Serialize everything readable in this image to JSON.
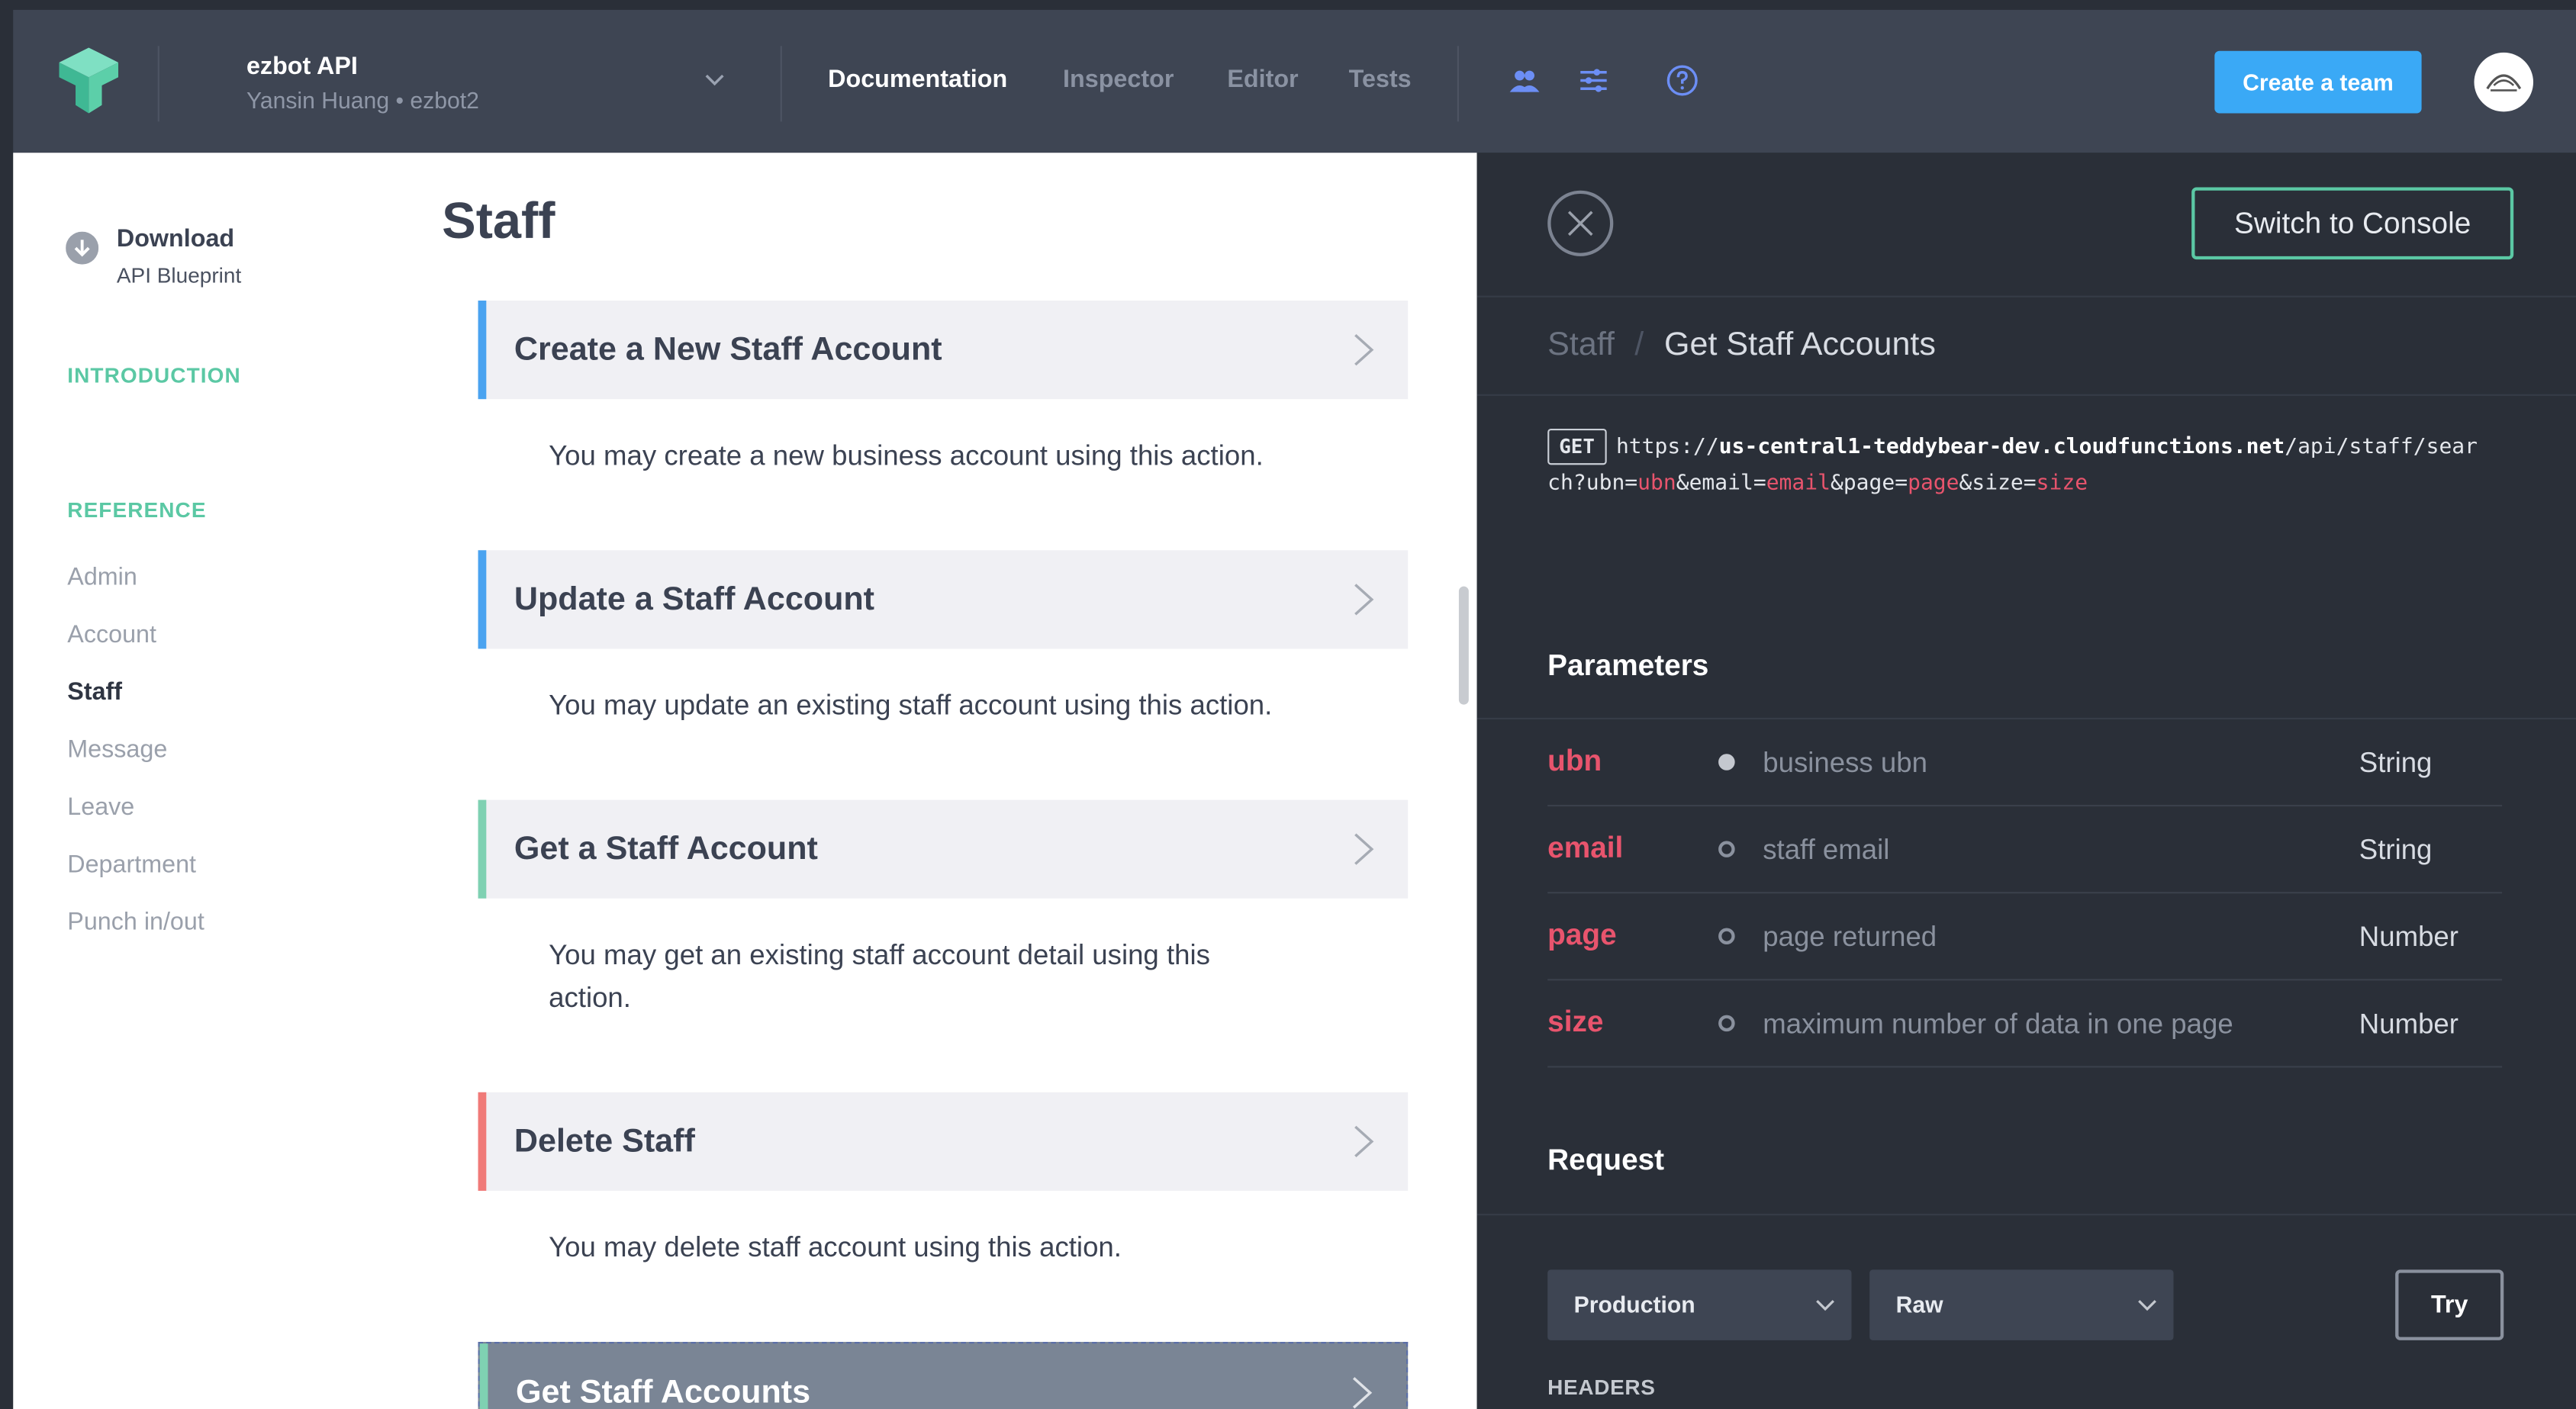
{
  "header": {
    "api_name": "ezbot API",
    "api_owner": "Yansin Huang • ezbot2",
    "nav": [
      "Documentation",
      "Inspector",
      "Editor",
      "Tests"
    ],
    "active_nav": "Documentation",
    "create_team_label": "Create a team",
    "icons": [
      "team-icon",
      "sliders-icon",
      "help-icon"
    ]
  },
  "sidebar": {
    "download_title": "Download",
    "download_sub": "API Blueprint",
    "introduction_label": "INTRODUCTION",
    "reference_label": "REFERENCE",
    "items": [
      "Admin",
      "Account",
      "Staff",
      "Message",
      "Leave",
      "Department",
      "Punch in/out"
    ],
    "active_item": "Staff"
  },
  "main": {
    "title": "Staff",
    "actions": [
      {
        "title": "Create a New Staff Account",
        "desc": "You may create a new business account using this action.",
        "color": "#4aa3f0"
      },
      {
        "title": "Update a Staff Account",
        "desc": "You may update an existing staff account using this action.",
        "color": "#4aa3f0"
      },
      {
        "title": "Get a Staff Account",
        "desc": "You may get an existing staff account detail using this action.",
        "color": "#7fd1b2"
      },
      {
        "title": "Delete Staff",
        "desc": "You may delete staff account using this action.",
        "color": "#f07a78"
      },
      {
        "title": "Get Staff Accounts",
        "desc": "",
        "color": "#7fd1b2"
      }
    ]
  },
  "panel": {
    "switch_label": "Switch to Console",
    "crumb_root": "Staff",
    "crumb_sep": "/",
    "crumb_current": "Get Staff Accounts",
    "method": "GET",
    "url_scheme": "https://",
    "url_host": "us-central1-teddybear-dev.cloudfunctions.net",
    "url_path_1": "/api/staff/sear",
    "url_path_2": "ch?ubn=",
    "url_q": [
      {
        "key": "ubn",
        "sep": "&email="
      },
      {
        "key": "email",
        "sep": "&page="
      },
      {
        "key": "page",
        "sep": "&size="
      },
      {
        "key": "size",
        "sep": ""
      }
    ],
    "params_heading": "Parameters",
    "params": [
      {
        "name": "ubn",
        "desc": "business ubn",
        "type": "String",
        "required": true
      },
      {
        "name": "email",
        "desc": "staff email",
        "type": "String",
        "required": false
      },
      {
        "name": "page",
        "desc": "page returned",
        "type": "Number",
        "required": false
      },
      {
        "name": "size",
        "desc": "maximum number of data in one page",
        "type": "Number",
        "required": false
      }
    ],
    "request_heading": "Request",
    "environment": "Production",
    "format": "Raw",
    "try_label": "Try",
    "headers_label": "HEADERS"
  },
  "colors": {
    "accent_blue": "#3aa9f6",
    "accent_green": "#5bc8a4",
    "param_red": "#e8546d"
  }
}
